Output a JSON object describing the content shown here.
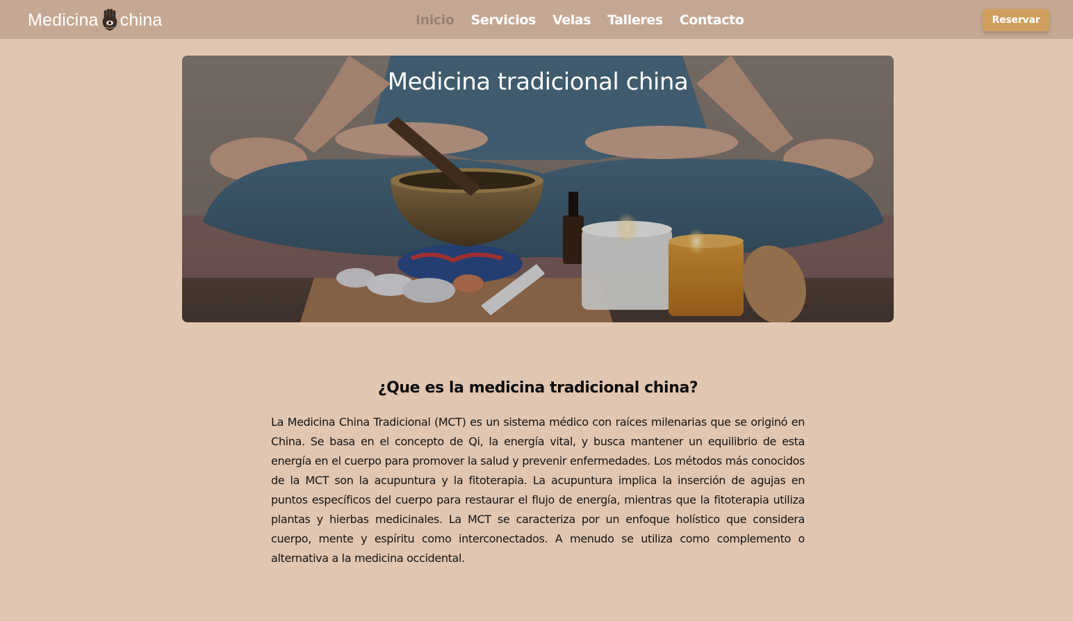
{
  "brand": {
    "name_left": "Medicina",
    "name_right": "china",
    "icon": "hamsa-icon"
  },
  "nav": {
    "items": [
      {
        "label": "Inicio",
        "active": true
      },
      {
        "label": "Servicios",
        "active": false
      },
      {
        "label": "Velas",
        "active": false
      },
      {
        "label": "Talleres",
        "active": false
      },
      {
        "label": "Contacto",
        "active": false
      }
    ],
    "cta_label": "Reservar"
  },
  "hero": {
    "title": "Medicina tradicional china",
    "image": "meditation-singing-bowl-candles-photo"
  },
  "about": {
    "title": "¿Que es la medicina tradicional china?",
    "body": "La Medicina China Tradicional (MCT) es un sistema médico con raíces milenarias que se originó en China. Se basa en el concepto de Qi, la energía vital, y busca mantener un equilibrio de esta energía en el cuerpo para promover la salud y prevenir enfermedades. Los métodos más conocidos de la MCT son la acupuntura y la fitoterapia. La acupuntura implica la inserción de agujas en puntos específicos del cuerpo para restaurar el flujo de energía, mientras que la fitoterapia utiliza plantas y hierbas medicinales. La MCT se caracteriza por un enfoque holístico que considera cuerpo, mente y espíritu como interconectados. A menudo se utiliza como complemento o alternativa a la medicina occidental."
  },
  "colors": {
    "page_bg": "#e1c6b1",
    "navbar_bg": "#c5a893",
    "nav_active": "#9a8173",
    "cta_bg": "#cf9f5e"
  }
}
